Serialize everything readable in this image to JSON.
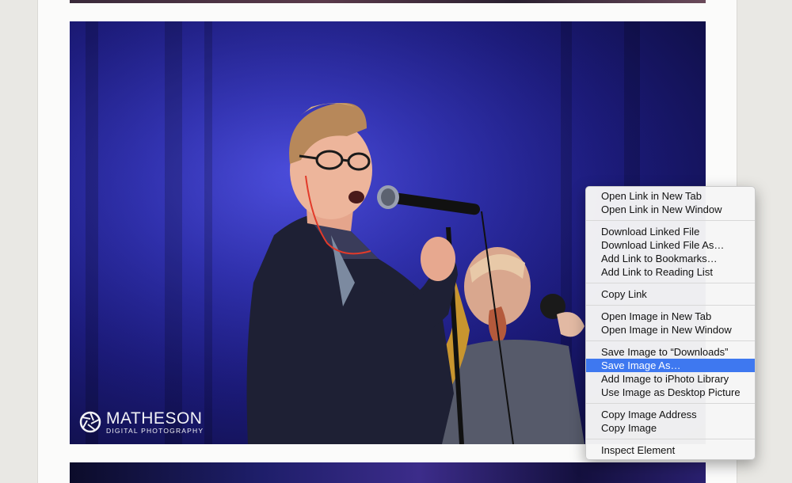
{
  "watermark": {
    "name": "MATHESON",
    "subtitle": "DIGITAL PHOTOGRAPHY"
  },
  "photo": {
    "subject": "singer-with-microphone-on-stage"
  },
  "colors": {
    "menu_highlight": "#3e78f0",
    "stage_light": "#2a2ba8"
  },
  "context_menu": {
    "groups": [
      [
        "Open Link in New Tab",
        "Open Link in New Window"
      ],
      [
        "Download Linked File",
        "Download Linked File As…",
        "Add Link to Bookmarks…",
        "Add Link to Reading List"
      ],
      [
        "Copy Link"
      ],
      [
        "Open Image in New Tab",
        "Open Image in New Window"
      ],
      [
        "Save Image to “Downloads”",
        "Save Image As…",
        "Add Image to iPhoto Library",
        "Use Image as Desktop Picture"
      ],
      [
        "Copy Image Address",
        "Copy Image"
      ],
      [
        "Inspect Element"
      ]
    ],
    "highlighted": "Save Image As…"
  }
}
